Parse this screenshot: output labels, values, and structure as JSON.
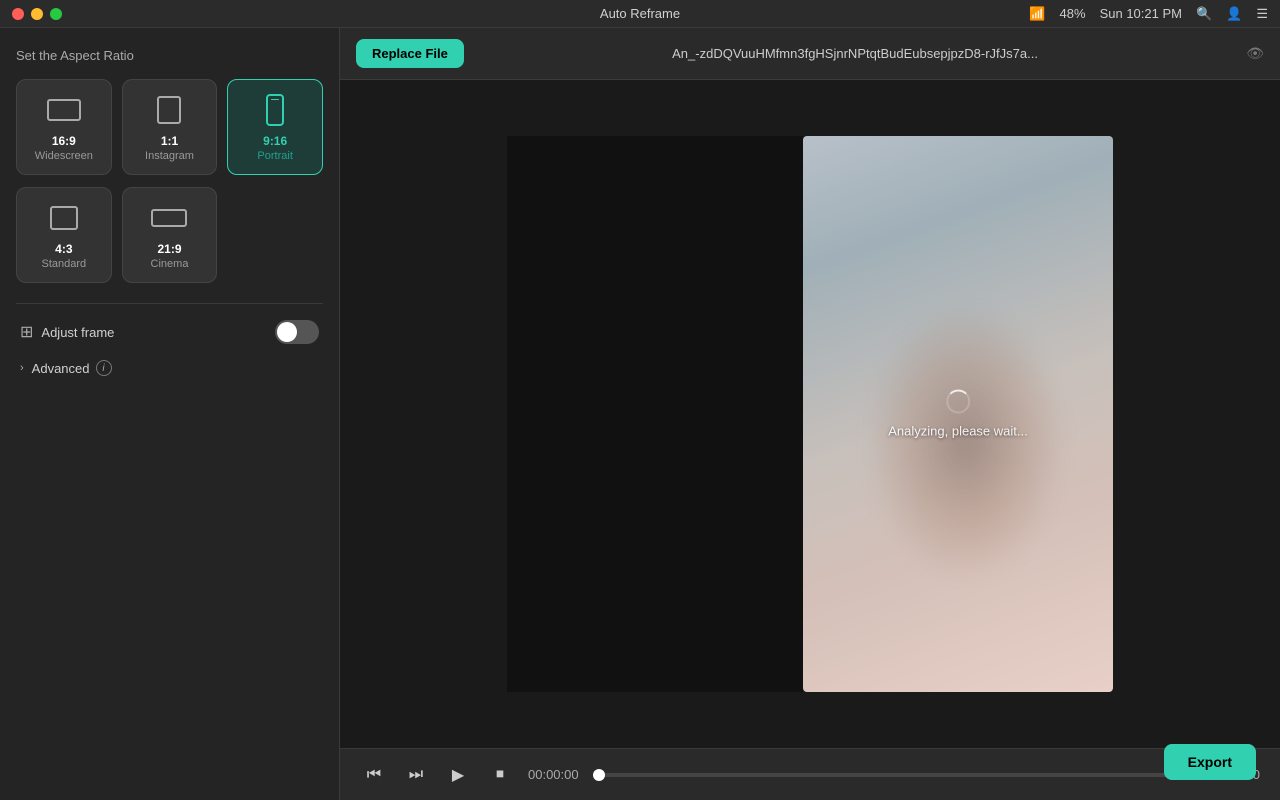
{
  "titlebar": {
    "appname": "Auto Reframe",
    "time": "Sun 10:21 PM",
    "battery": "48%"
  },
  "sidebar": {
    "heading": "Set the Aspect Ratio",
    "aspect_ratios": [
      {
        "id": "widescreen",
        "ratio": "16:9",
        "label": "Widescreen",
        "selected": false
      },
      {
        "id": "instagram",
        "ratio": "1:1",
        "label": "Instagram",
        "selected": false
      },
      {
        "id": "portrait",
        "ratio": "9:16",
        "label": "Portrait",
        "selected": true
      },
      {
        "id": "standard",
        "ratio": "4:3",
        "label": "Standard",
        "selected": false
      },
      {
        "id": "cinema",
        "ratio": "21:9",
        "label": "Cinema",
        "selected": false
      }
    ],
    "adjust_frame": {
      "label": "Adjust frame",
      "enabled": false
    },
    "advanced": {
      "label": "Advanced",
      "info_icon": "i"
    }
  },
  "topbar": {
    "replace_file_label": "Replace File",
    "filename": "An_-zdDQVuuHMfmn3fgHSjnrNPtqtBudEubsepjpzD8-rJfJs7a..."
  },
  "video": {
    "analyzing_text": "Analyzing, please wait..."
  },
  "playback": {
    "current_time": "00:00:00",
    "total_time": "00:00:00"
  },
  "export": {
    "label": "Export"
  }
}
